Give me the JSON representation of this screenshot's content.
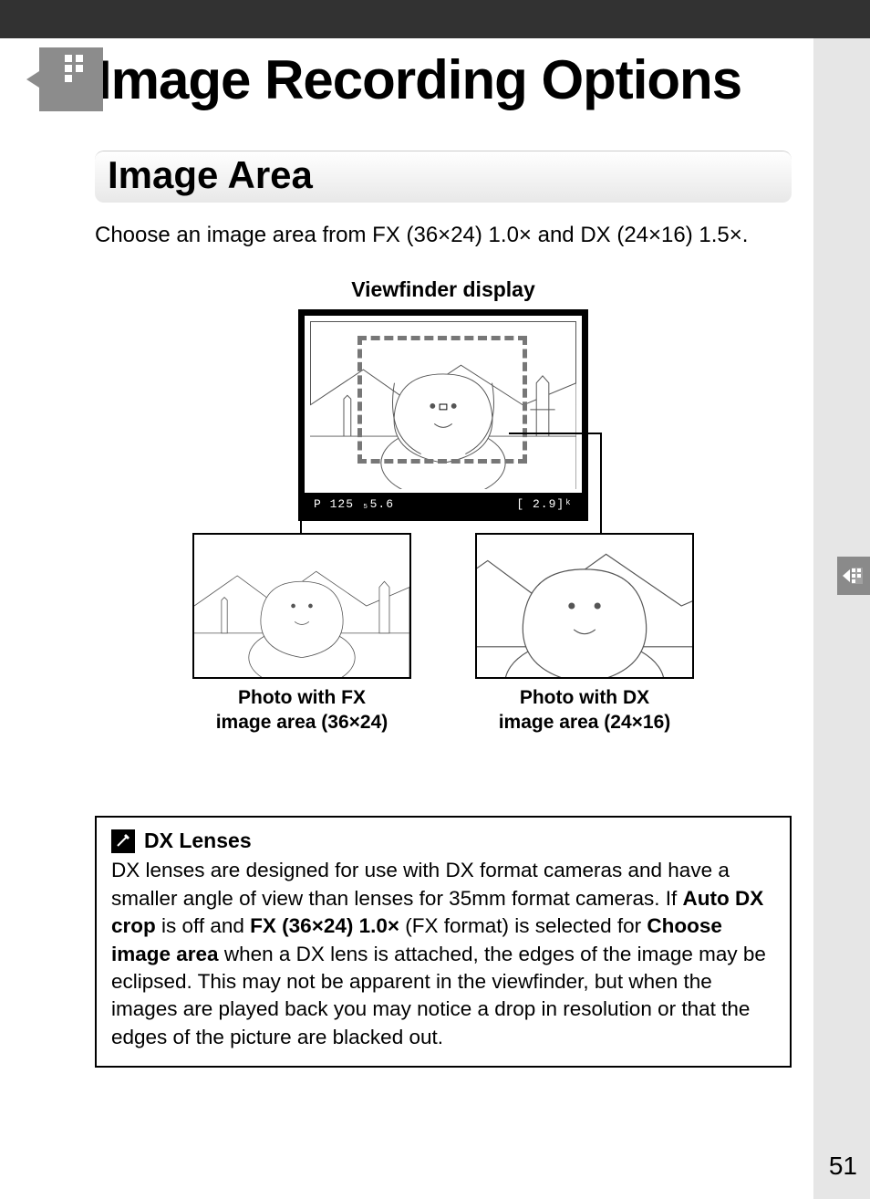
{
  "page_number": "51",
  "chapter": {
    "title": "Image Recording Options"
  },
  "section": {
    "title": "Image Area"
  },
  "intro": "Choose an image area from FX (36×24) 1.0× and DX (24×16) 1.5×.",
  "diagram": {
    "viewfinder_label": "Viewfinder display",
    "viewfinder_status_left": "P  125  ₅5.6",
    "viewfinder_status_right": "[ 2.9]ᵏ",
    "fx_caption_line1": "Photo with FX",
    "fx_caption_line2": "image area (36×24)",
    "dx_caption_line1": "Photo with DX",
    "dx_caption_line2": "image area (24×16)"
  },
  "note": {
    "title": "DX Lenses",
    "text_before_b1": "DX lenses are designed for use with DX format cameras and have a smaller angle of view than lenses for 35mm format cameras.  If ",
    "b1": "Auto DX crop",
    "text_mid1": " is off and ",
    "b2": "FX (36×24) 1.0×",
    "text_mid2": " (FX format) is selected for ",
    "b3": "Choose image area",
    "text_after": " when a DX lens is attached, the edges of the image may be eclipsed.  This may not be apparent in the viewfinder, but when the images are played back you may notice a drop in resolution or that the edges of the picture are blacked out."
  }
}
